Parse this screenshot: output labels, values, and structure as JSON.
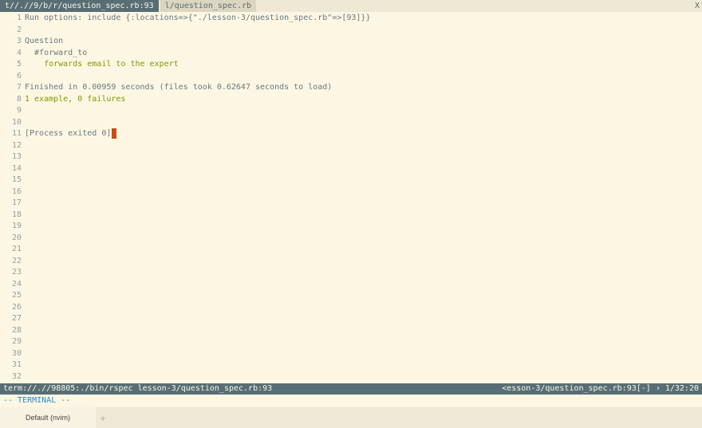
{
  "tabs": [
    {
      "label": "t//.//9/b/r/question_spec.rb:93",
      "active": true
    },
    {
      "label": "l/question_spec.rb",
      "active": false
    }
  ],
  "tab_close": "X",
  "buffer_lines": [
    {
      "num": "1",
      "text": "Run options: include {:locations=>{\"./lesson-3/question_spec.rb\"=>[93]}}",
      "style": "plain"
    },
    {
      "num": "2",
      "text": "",
      "style": "plain"
    },
    {
      "num": "3",
      "text": "Question",
      "style": "plain"
    },
    {
      "num": "4",
      "text": "  #forward_to",
      "style": "plain"
    },
    {
      "num": "5",
      "text": "    forwards email to the expert",
      "style": "green"
    },
    {
      "num": "6",
      "text": "",
      "style": "plain"
    },
    {
      "num": "7",
      "text": "Finished in 0.00959 seconds (files took 0.62647 seconds to load)",
      "style": "plain"
    },
    {
      "num": "8",
      "text": "1 example, 0 failures",
      "style": "green"
    },
    {
      "num": "9",
      "text": "",
      "style": "plain"
    },
    {
      "num": "10",
      "text": "",
      "style": "plain"
    },
    {
      "num": "11",
      "text": "[Process exited 0]",
      "style": "plain",
      "cursor": true
    },
    {
      "num": "12",
      "text": "",
      "style": "plain"
    },
    {
      "num": "13",
      "text": "",
      "style": "plain"
    },
    {
      "num": "14",
      "text": "",
      "style": "plain"
    },
    {
      "num": "15",
      "text": "",
      "style": "plain"
    },
    {
      "num": "16",
      "text": "",
      "style": "plain"
    },
    {
      "num": "17",
      "text": "",
      "style": "plain"
    },
    {
      "num": "18",
      "text": "",
      "style": "plain"
    },
    {
      "num": "19",
      "text": "",
      "style": "plain"
    },
    {
      "num": "20",
      "text": "",
      "style": "plain"
    },
    {
      "num": "21",
      "text": "",
      "style": "plain"
    },
    {
      "num": "22",
      "text": "",
      "style": "plain"
    },
    {
      "num": "23",
      "text": "",
      "style": "plain"
    },
    {
      "num": "24",
      "text": "",
      "style": "plain"
    },
    {
      "num": "25",
      "text": "",
      "style": "plain"
    },
    {
      "num": "26",
      "text": "",
      "style": "plain"
    },
    {
      "num": "27",
      "text": "",
      "style": "plain"
    },
    {
      "num": "28",
      "text": "",
      "style": "plain"
    },
    {
      "num": "29",
      "text": "",
      "style": "plain"
    },
    {
      "num": "30",
      "text": "",
      "style": "plain"
    },
    {
      "num": "31",
      "text": "",
      "style": "plain"
    },
    {
      "num": "32",
      "text": "",
      "style": "plain"
    }
  ],
  "statusline": {
    "left": "term://.//98805:./bin/rspec lesson-3/question_spec.rb:93",
    "right": "<esson-3/question_spec.rb:93[-] › 1/32:20"
  },
  "cmdline": "-- TERMINAL --",
  "terminal_tab": {
    "label": "Default (nvim)"
  },
  "add_tab_icon": "+",
  "colors": {
    "background": "#fdf6e3",
    "text": "#657b83",
    "green": "#859900",
    "line_number": "#93a1a1",
    "statusline_bg": "#586e75",
    "cursor": "#cb4b16",
    "cmdline": "#268bd2"
  }
}
